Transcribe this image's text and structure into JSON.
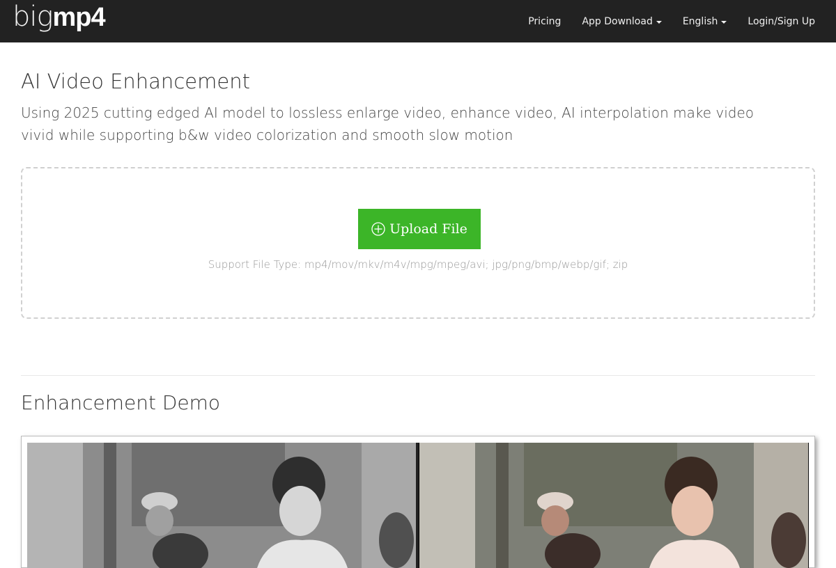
{
  "navbar": {
    "logo_thin": "big",
    "logo_bold": "mp4",
    "links": [
      {
        "label": "Pricing",
        "dropdown": false
      },
      {
        "label": "App Download",
        "dropdown": true
      },
      {
        "label": "English",
        "dropdown": true
      },
      {
        "label": "Login/Sign Up",
        "dropdown": false
      }
    ]
  },
  "main": {
    "title": "AI Video Enhancement",
    "description": "Using 2025 cutting edged AI model to lossless enlarge video, enhance video, AI interpolation make video vivid while supporting b&w video colorization and smooth slow motion",
    "upload": {
      "button_label": "Upload File",
      "support_text": "Support File Type: mp4/mov/mkv/m4v/mpg/mpeg/avi; jpg/png/bmp/webp/gif; zip"
    }
  },
  "demo": {
    "title": "Enhancement Demo"
  },
  "colors": {
    "navbar_bg": "#222222",
    "upload_button": "#3cb528",
    "upload_border": "#d0d0d0"
  }
}
